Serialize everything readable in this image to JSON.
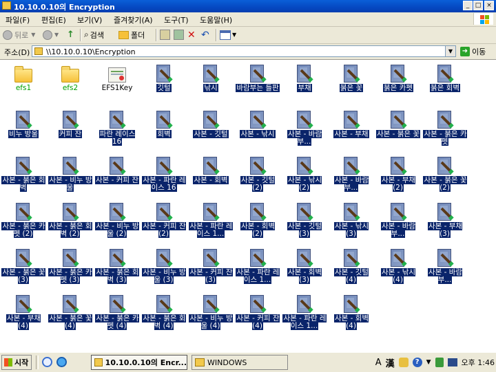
{
  "window": {
    "title": "10.10.0.10의 Encryption",
    "controls": [
      "_",
      "□",
      "×"
    ]
  },
  "menu": [
    "파일(F)",
    "편집(E)",
    "보기(V)",
    "즐겨찾기(A)",
    "도구(T)",
    "도움말(H)"
  ],
  "toolbar": {
    "back_label": "뒤로",
    "search_label": "검색",
    "folders_label": "폴더"
  },
  "address": {
    "label": "주소(D)",
    "value": "\\\\10.10.0.10\\Encryption",
    "go_label": "이동"
  },
  "items": [
    {
      "name": "efs1",
      "type": "folder"
    },
    {
      "name": "efs2",
      "type": "folder"
    },
    {
      "name": "EFS1Key",
      "type": "certificate"
    },
    {
      "name": "깃털",
      "type": "bmp"
    },
    {
      "name": "낚시",
      "type": "bmp"
    },
    {
      "name": "바람부는 들판",
      "type": "bmp"
    },
    {
      "name": "부채",
      "type": "bmp"
    },
    {
      "name": "붉은 꽃",
      "type": "bmp"
    },
    {
      "name": "붉은 카펫",
      "type": "bmp"
    },
    {
      "name": "붉은 회벽",
      "type": "bmp"
    },
    {
      "name": "비누 방울",
      "type": "bmp"
    },
    {
      "name": "커피 잔",
      "type": "bmp"
    },
    {
      "name": "파란 레이스 16",
      "type": "bmp"
    },
    {
      "name": "회벽",
      "type": "bmp"
    },
    {
      "name": "사본 - 깃털",
      "type": "bmp"
    },
    {
      "name": "사본 - 낚시",
      "type": "bmp"
    },
    {
      "name": "사본 - 바람부...",
      "type": "bmp"
    },
    {
      "name": "사본 - 부채",
      "type": "bmp"
    },
    {
      "name": "사본 - 붉은 꽃",
      "type": "bmp"
    },
    {
      "name": "사본 - 붉은 카펫",
      "type": "bmp"
    },
    {
      "name": "사본 - 붉은 회벽",
      "type": "bmp"
    },
    {
      "name": "사본 - 비누 방울",
      "type": "bmp"
    },
    {
      "name": "사본 - 커피 잔",
      "type": "bmp"
    },
    {
      "name": "사본 - 파란 레이스 16",
      "type": "bmp"
    },
    {
      "name": "사본 - 회벽",
      "type": "bmp"
    },
    {
      "name": "사본 - 깃털 (2)",
      "type": "bmp"
    },
    {
      "name": "사본 - 낚시 (2)",
      "type": "bmp"
    },
    {
      "name": "사본 - 바람부...",
      "type": "bmp"
    },
    {
      "name": "사본 - 부채 (2)",
      "type": "bmp"
    },
    {
      "name": "사본 - 붉은 꽃 (2)",
      "type": "bmp"
    },
    {
      "name": "사본 - 붉은 카펫 (2)",
      "type": "bmp"
    },
    {
      "name": "사본 - 붉은 회벽 (2)",
      "type": "bmp"
    },
    {
      "name": "사본 - 비누 방울 (2)",
      "type": "bmp"
    },
    {
      "name": "사본 - 커피 잔 (2)",
      "type": "bmp"
    },
    {
      "name": "사본 - 파란 레이스 1...",
      "type": "bmp"
    },
    {
      "name": "사본 - 회벽 (2)",
      "type": "bmp"
    },
    {
      "name": "사본 - 깃털 (3)",
      "type": "bmp"
    },
    {
      "name": "사본 - 낚시 (3)",
      "type": "bmp"
    },
    {
      "name": "사본 - 바람부...",
      "type": "bmp"
    },
    {
      "name": "사본 - 부채 (3)",
      "type": "bmp"
    },
    {
      "name": "사본 - 붉은 꽃 (3)",
      "type": "bmp"
    },
    {
      "name": "사본 - 붉은 카펫 (3)",
      "type": "bmp"
    },
    {
      "name": "사본 - 붉은 회벽 (3)",
      "type": "bmp"
    },
    {
      "name": "사본 - 비누 방울 (3)",
      "type": "bmp"
    },
    {
      "name": "사본 - 커피 잔 (3)",
      "type": "bmp"
    },
    {
      "name": "사본 - 파란 레이스 1...",
      "type": "bmp"
    },
    {
      "name": "사본 - 회벽 (3)",
      "type": "bmp"
    },
    {
      "name": "사본 - 깃털 (4)",
      "type": "bmp"
    },
    {
      "name": "사본 - 낚시 (4)",
      "type": "bmp"
    },
    {
      "name": "사본 - 바람부...",
      "type": "bmp"
    },
    {
      "name": "사본 - 부채 (4)",
      "type": "bmp"
    },
    {
      "name": "사본 - 붉은 꽃 (4)",
      "type": "bmp"
    },
    {
      "name": "사본 - 붉은 카펫 (4)",
      "type": "bmp"
    },
    {
      "name": "사본 - 붉은 회벽 (4)",
      "type": "bmp"
    },
    {
      "name": "사본 - 비누 방울 (4)",
      "type": "bmp"
    },
    {
      "name": "사본 - 커피 잔 (4)",
      "type": "bmp"
    },
    {
      "name": "사본 - 파란 레이스 1...",
      "type": "bmp"
    },
    {
      "name": "사본 - 회벽 (4)",
      "type": "bmp"
    }
  ],
  "taskbar": {
    "start_label": "시작",
    "tasks": [
      "10.10.0.10의 Encr...",
      "WINDOWS"
    ],
    "ime": [
      "A",
      "漢"
    ],
    "clock": "오후 1:46"
  },
  "colors": {
    "titlebar": "#0548c1",
    "selection": "#0a246a",
    "chrome": "#ece9d8"
  }
}
